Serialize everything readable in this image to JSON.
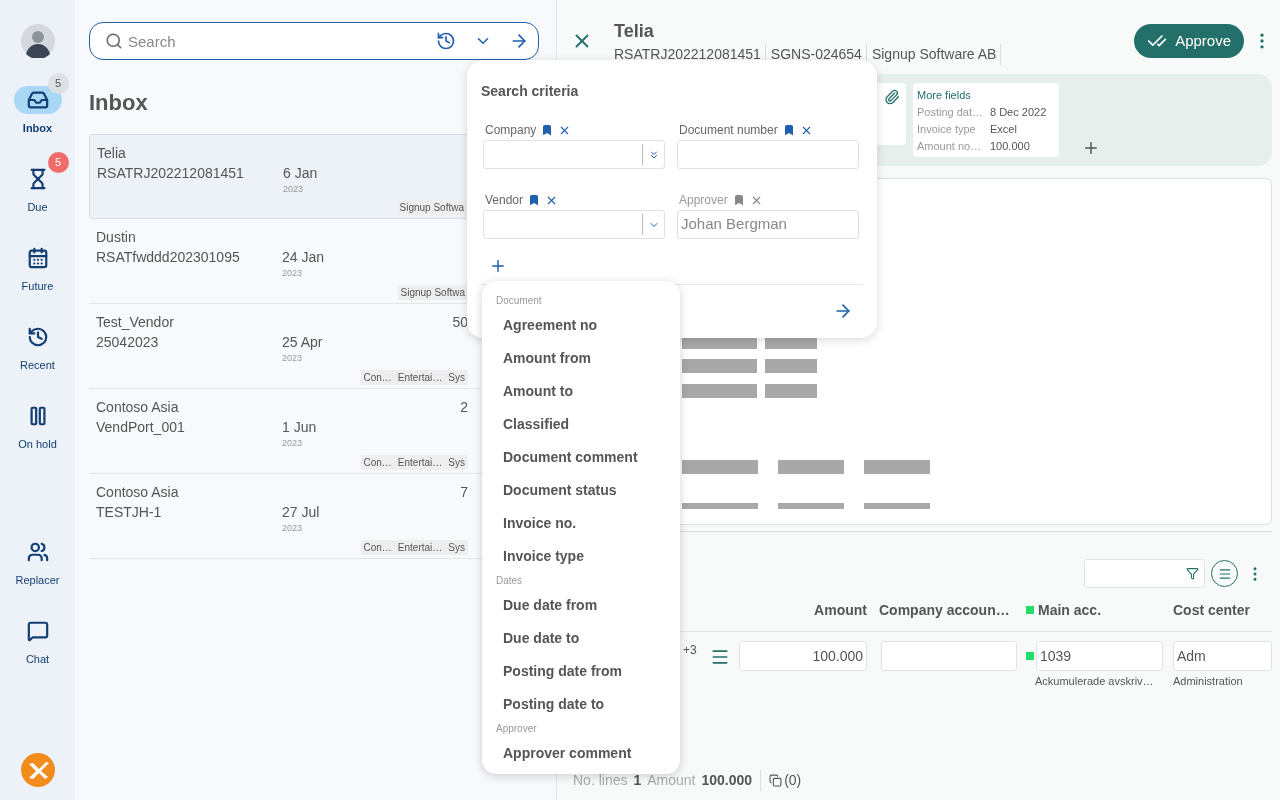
{
  "sidebar": {
    "nav": [
      {
        "label": "Inbox",
        "selected": true,
        "badge": {
          "text": "5",
          "color": "#dde1e6"
        }
      },
      {
        "label": "Due",
        "selected": false,
        "badge": {
          "text": "5",
          "color": "#f26b6b"
        }
      },
      {
        "label": "Future",
        "selected": false
      },
      {
        "label": "Recent",
        "selected": false
      },
      {
        "label": "On hold",
        "selected": false
      }
    ],
    "nav_bottom": [
      {
        "label": "Replacer",
        "selected": false
      },
      {
        "label": "Chat",
        "selected": false
      }
    ]
  },
  "search": {
    "placeholder": "Search"
  },
  "inbox": {
    "title": "Inbox",
    "items": [
      {
        "vendor": "Telia",
        "number": "RSATRJ202212081451",
        "date": "6 Jan",
        "year": "2023",
        "tags": [
          "Signup Softwa"
        ],
        "selected": true
      },
      {
        "vendor": "Dustin",
        "number": "RSATfwddd202301095",
        "date": "24 Jan",
        "year": "2023",
        "tags": [
          "Signup Softwa"
        ],
        "selected": false
      },
      {
        "vendor": "Test_Vendor",
        "number": "25042023",
        "date": "25 Apr",
        "year": "2023",
        "amount": "50",
        "tags": [
          "Con…",
          "Entertai…",
          "Sys"
        ],
        "selected": false
      },
      {
        "vendor": "Contoso Asia",
        "number": "VendPort_001",
        "date": "1 Jun",
        "year": "2023",
        "amount": "2",
        "tags": [
          "Con…",
          "Entertai…",
          "Sys"
        ],
        "selected": false
      },
      {
        "vendor": "Contoso Asia",
        "number": "TESTJH-1",
        "date": "27 Jul",
        "year": "2023",
        "amount": "7",
        "tags": [
          "Con…",
          "Entertai…",
          "Sys"
        ],
        "selected": false
      }
    ]
  },
  "document": {
    "title": "Telia",
    "meta": [
      "RSATRJ202212081451",
      "SGNS-024654",
      "Signup Software AB"
    ],
    "approve": "Approve",
    "more_fields": {
      "title": "More fields",
      "rows": [
        {
          "label": "Posting dat…",
          "value": "8 Dec 2022"
        },
        {
          "label": "Invoice type",
          "value": "Excel"
        },
        {
          "label": "Amount no…",
          "value": "100.000"
        }
      ]
    }
  },
  "lines": {
    "columns": [
      {
        "label": "Amount"
      },
      {
        "label": "Company accoun…"
      },
      {
        "label": "Main acc.",
        "color": "#22dd66"
      },
      {
        "label": "Cost center"
      }
    ],
    "rows": [
      {
        "extra": "+3",
        "amount": "100.000",
        "main_acc": {
          "value": "1039",
          "color": "#22dd66",
          "name": "Ackumulerade avskriv…"
        },
        "cost_center": "Adm",
        "cost_center_name": "Administration"
      }
    ]
  },
  "footer": {
    "lines_label": "No. lines",
    "lines_value": "1",
    "amount_label": "Amount",
    "amount_value": "100.000",
    "attachments": "(0)"
  },
  "search_criteria": {
    "title": "Search criteria",
    "fields": [
      {
        "label": "Company",
        "kind": "multiselect",
        "disabled": false
      },
      {
        "label": "Document number",
        "kind": "text",
        "disabled": false
      },
      {
        "label": "Vendor",
        "kind": "select",
        "disabled": false
      },
      {
        "label": "Approver",
        "kind": "text",
        "disabled": true,
        "value": "Johan Bergman"
      }
    ]
  },
  "field_menu": {
    "groups": [
      {
        "title": "Document",
        "items": [
          "Agreement no",
          "Amount from",
          "Amount to",
          "Classified",
          "Document comment",
          "Document status",
          "Invoice no.",
          "Invoice type"
        ]
      },
      {
        "title": "Dates",
        "items": [
          "Due date from",
          "Due date to",
          "Posting date from",
          "Posting date to"
        ]
      },
      {
        "title": "Approver",
        "items": [
          "Approver comment"
        ]
      }
    ]
  }
}
